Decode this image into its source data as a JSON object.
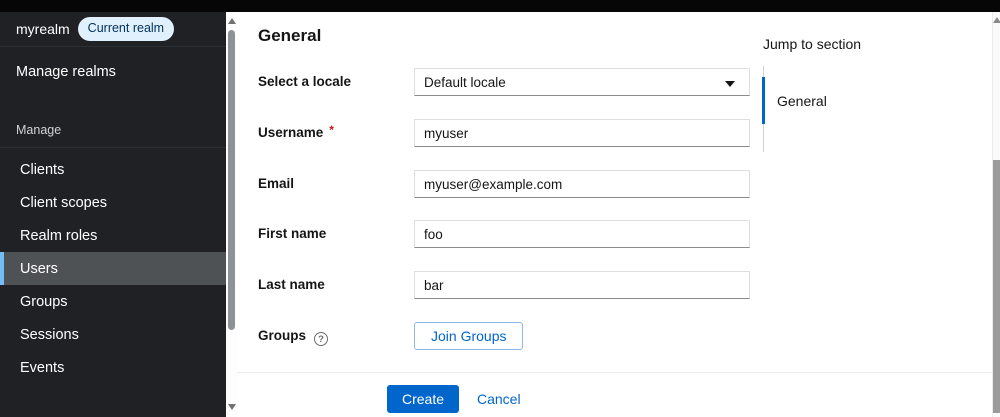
{
  "sidebar": {
    "realm_name": "myrealm",
    "realm_badge": "Current realm",
    "manage_realms_label": "Manage realms",
    "section_title": "Manage",
    "items": [
      {
        "label": "Clients",
        "active": false
      },
      {
        "label": "Client scopes",
        "active": false
      },
      {
        "label": "Realm roles",
        "active": false
      },
      {
        "label": "Users",
        "active": true
      },
      {
        "label": "Groups",
        "active": false
      },
      {
        "label": "Sessions",
        "active": false
      },
      {
        "label": "Events",
        "active": false
      }
    ]
  },
  "main": {
    "title": "General",
    "form": {
      "fields": [
        {
          "label": "Select a locale",
          "type": "select",
          "value": "Default locale"
        },
        {
          "label": "Username",
          "required": "*",
          "type": "text",
          "value": "myuser"
        },
        {
          "label": "Email",
          "type": "text",
          "value": "myuser@example.com"
        },
        {
          "label": "First name",
          "type": "text",
          "value": "foo"
        },
        {
          "label": "Last name",
          "type": "text",
          "value": "bar"
        },
        {
          "label": "Groups",
          "help": "?",
          "type": "button",
          "button_label": "Join Groups"
        }
      ]
    },
    "actions": {
      "create_label": "Create",
      "cancel_label": "Cancel"
    }
  },
  "jump_nav": {
    "title": "Jump to section",
    "links": [
      {
        "label": "General",
        "active": true
      }
    ]
  },
  "colors": {
    "accent": "#0066cc",
    "nav_active_indicator": "#73bcf7",
    "sidebar_bg": "#1f2125",
    "nav_active_bg": "#4f5255",
    "badge_bg": "#e0f0fc",
    "badge_text": "#00315c",
    "required_asterisk": "#c9190b",
    "input_bottom_border": "#8a8d90"
  }
}
